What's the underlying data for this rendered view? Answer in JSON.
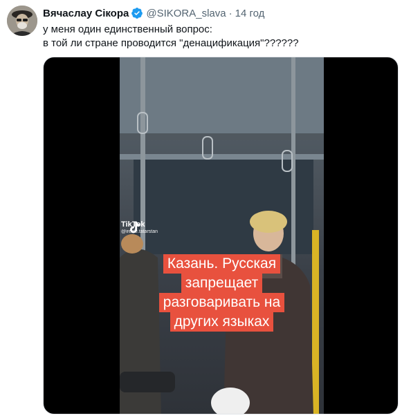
{
  "tweet": {
    "author_name": "Вячаслау Сікора",
    "handle": "@SIKORA_slava",
    "separator": "·",
    "time": "14 год",
    "text_lines": [
      "у меня один единственный вопрос:",
      "в той ли стране проводится \"денацификация\"??????"
    ]
  },
  "video": {
    "watermark_app": "TikTok",
    "watermark_user": "@irekle.tatarstan",
    "caption_lines": [
      "Казань. Русская",
      "запрещает",
      "разговаривать на",
      "других языках"
    ],
    "caption_color": "#e8513e"
  },
  "colors": {
    "verified": "#1d9bf0",
    "secondary_text": "#536471",
    "primary_text": "#0f1419"
  },
  "icons": [
    "verified-badge-icon",
    "tiktok-logo-icon"
  ]
}
